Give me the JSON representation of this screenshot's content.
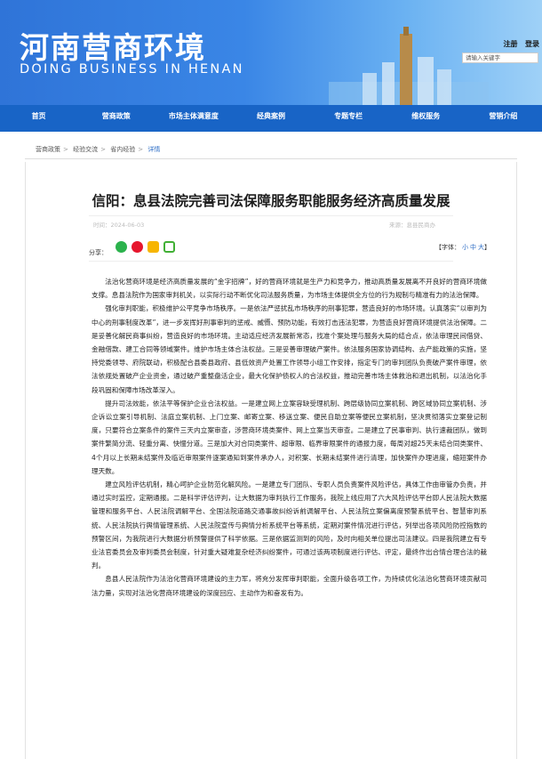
{
  "header": {
    "title": "河南营商环境",
    "subtitle": "DOING BUSINESS IN HENAN",
    "links": [
      "注册",
      "登录"
    ],
    "search_placeholder": "请输入关键字"
  },
  "nav": [
    "首页",
    "营商政策",
    "市场主体满意度",
    "经典案例",
    "专题专栏",
    "维权服务",
    "营销介绍"
  ],
  "breadcrumb": [
    "营商政策",
    "经验交流",
    "省内经验",
    "详情"
  ],
  "article": {
    "title": "信阳：息县法院完善司法保障服务职能服务经济高质量发展",
    "time": "时间：2024-06-03",
    "source": "来源：息县民商办",
    "share_label": "分享：",
    "font_label": "【字体：",
    "font_sizes": [
      "小",
      "中",
      "大"
    ],
    "font_close": "】",
    "paragraphs": [
      "法治化营商环境是经济高质量发展的“金字招牌”，好的营商环境就是生产力和竞争力，推动高质量发展离不开良好的营商环境做支撑。息县法院作为国家审判机关，以实际行动不断优化司法服务质量，为市场主体提供全方位的行为规制与精准有力的法治保障。",
      "强化审判职能，积极维护公平竞争市场秩序。一是依法严惩扰乱市场秩序的刑事犯罪，营造良好的市场环境。认真落实“以审判为中心的刑事制度改革”，进一步发挥好刑事审判的惩戒、威慑、预防功能，有效打击违法犯罪，为营造良好营商环境提供法治保障。二是妥善化解民商事纠纷，营造良好的市场环境。主动适应经济发展新常态，找准个案处理与服务大局的结合点，依法审理民间借贷、金融借款、建工合同等领域案件。维护市场主体合法权益。三是妥善审理破产案件。依法服务国家协调结构、去产能政策的实施，坚持党委领导、府院联动，积极配合县委县政府、县低效资产处置工作领导小组工作安排，指定专门的审判团队负责破产案件审理，依法依规处置破产企业资金，通过破产重整盘活企业，最大化保护债权人的合法权益，推动完善市场主体救治和退出机制，以法治化手段巩固和保障市场改革深入。",
      "提升司法效能，依法平等保护企业合法权益。一是建立网上立案容缺受理机制、跨层级协同立案机制、跨区域协同立案机制、涉企诉讼立案引导机制、法庭立案机制、上门立案、邮寄立案、移送立案、便民自助立案等便民立案机制，坚决贯彻落实立案登记制度，只要符合立案条件的案件三天内立案审查，涉营商环境类案件、网上立案当天审查。二是建立了民事审判、执行速裁团队，做到案件繁简分流、轻重分离、快慢分道。三是加大对合同类案件、超审限、临界审限案件的通报力度，每周对超25天未结合同类案件、4个月以上长期未结案件及临近审限案件逐案通知到案件承办人，对积案、长期未结案件进行清理，加快案件办理进度，缩短案件办理天数。",
      "建立风险评估机制，精心呵护企业防范化解风险。一是建立专门团队、专职人员负责案件风险评估，具体工作由审管办负责，并通过实时监控，定期通报。二是科学评估评判，让大数据为审判执行工作服务，我院上线应用了六大风险评估平台即人民法院大数据管理和服务平台、人民法院调解平台、全国法院道路交通事故纠纷诉前调解平台、人民法院立案偏离度预警系统平台、智慧审判系统、人民法院执行舆情管理系统、人民法院宣传与舆情分析系统平台等系统，定期对案件情况进行评估，列举出各项风险防控指数的预警区间，为我院进行大数据分析预警提供了科学依据。三是依据监测到的风险，及时向相关单位提出司法建议。四是我院建立有专业法官委员会及审判委员会制度，针对重大疑难复杂经济纠纷案件，可通过该两项制度进行评估、评定，最终作出合情合理合法的裁判。",
      "息县人民法院作为法治化营商环境建设的主力军，将充分发挥审判职能，全面升级各项工作，为持续优化法治化营商环境贡献司法力量，实现对法治化营商环境建设的深度回应、主动作为和奋发有为。"
    ]
  },
  "colors": {
    "nav": "#1864c6",
    "banner": "#3a86e6",
    "link": "#2f6fc6"
  }
}
